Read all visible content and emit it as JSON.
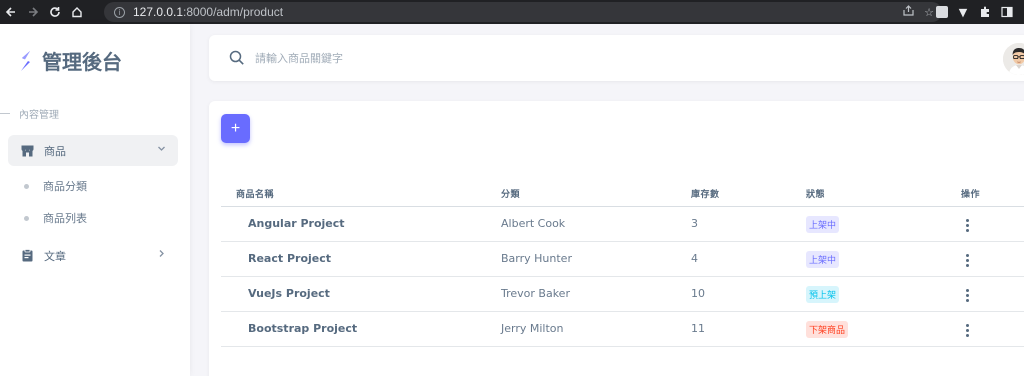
{
  "browser": {
    "url_host": "127.0.0.1",
    "url_rest": ":8000/adm/product"
  },
  "brand": {
    "title": "管理後台"
  },
  "sidebar": {
    "section": "內容管理",
    "items": [
      {
        "label": "商品",
        "icon": "store-icon",
        "active": true,
        "expanded": true,
        "children": [
          {
            "label": "商品分類"
          },
          {
            "label": "商品列表"
          }
        ]
      },
      {
        "label": "文章",
        "icon": "clipboard-icon",
        "active": false,
        "expanded": false
      }
    ]
  },
  "search": {
    "placeholder": "請輸入商品關鍵字"
  },
  "toolbar": {
    "add_label": "+"
  },
  "table": {
    "columns": [
      "商品名稱",
      "分類",
      "庫存數",
      "狀態",
      "操作"
    ],
    "rows": [
      {
        "name": "Angular Project",
        "category": "Albert Cook",
        "stock": "3",
        "status": "上架中",
        "status_type": "primary"
      },
      {
        "name": "React Project",
        "category": "Barry Hunter",
        "stock": "4",
        "status": "上架中",
        "status_type": "primary"
      },
      {
        "name": "VueJs Project",
        "category": "Trevor Baker",
        "stock": "10",
        "status": "預上架",
        "status_type": "info"
      },
      {
        "name": "Bootstrap Project",
        "category": "Jerry Milton",
        "stock": "11",
        "status": "下架商品",
        "status_type": "danger"
      }
    ]
  },
  "colors": {
    "accent": "#696cff",
    "info": "#03c3ec",
    "danger": "#ff3e1d",
    "text": "#566a7f"
  }
}
